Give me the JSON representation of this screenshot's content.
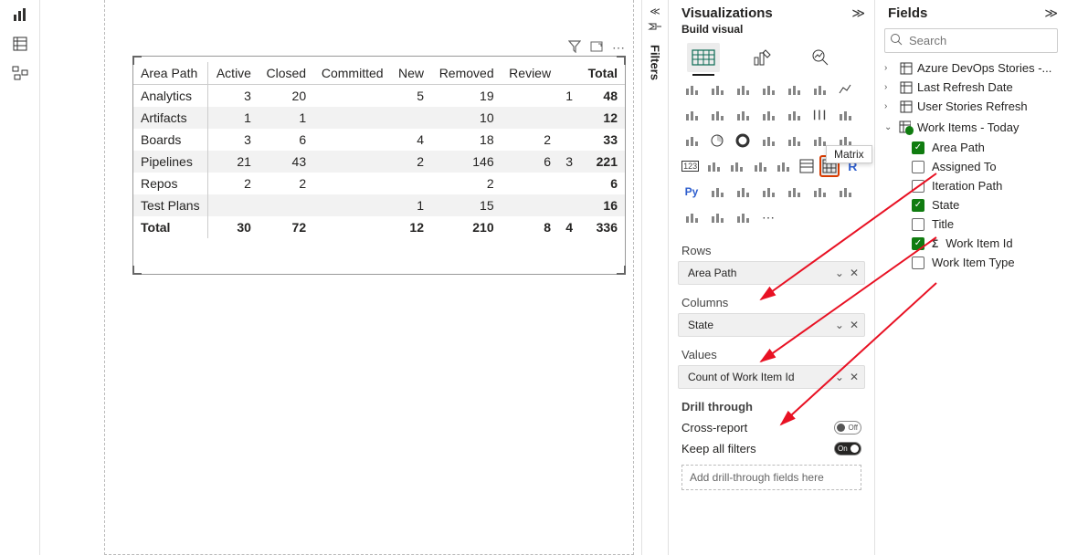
{
  "leftbar": {
    "items": [
      "bar-chart-icon",
      "table-icon",
      "model-icon"
    ]
  },
  "filters": {
    "label": "Filters"
  },
  "viz_panel": {
    "title": "Visualizations",
    "subtitle": "Build visual",
    "tooltip": "Matrix",
    "sections": {
      "rows": {
        "label": "Rows",
        "item": "Area Path"
      },
      "columns": {
        "label": "Columns",
        "item": "State"
      },
      "values": {
        "label": "Values",
        "item": "Count of Work Item Id"
      }
    },
    "drill": {
      "label": "Drill through",
      "cross_report": "Cross-report",
      "cross_report_state": "Off",
      "keep_filters": "Keep all filters",
      "keep_filters_state": "On",
      "drop": "Add drill-through fields here"
    }
  },
  "fields_panel": {
    "title": "Fields",
    "search_placeholder": "Search",
    "tables": [
      {
        "name": "Azure DevOps Stories -...",
        "expanded": false
      },
      {
        "name": "Last Refresh Date",
        "expanded": false
      },
      {
        "name": "User Stories Refresh",
        "expanded": false
      },
      {
        "name": "Work Items - Today",
        "expanded": true,
        "inuse": true,
        "fields": [
          {
            "name": "Area Path",
            "checked": true
          },
          {
            "name": "Assigned To",
            "checked": false
          },
          {
            "name": "Iteration Path",
            "checked": false
          },
          {
            "name": "State",
            "checked": true
          },
          {
            "name": "Title",
            "checked": false
          },
          {
            "name": "Work Item Id",
            "checked": true,
            "sigma": true
          },
          {
            "name": "Work Item Type",
            "checked": false
          }
        ]
      }
    ]
  },
  "chart_data": {
    "type": "table",
    "title": "",
    "row_field": "Area Path",
    "column_field": "State",
    "value_field": "Count of Work Item Id",
    "columns": [
      "Area Path",
      "Active",
      "Closed",
      "Committed",
      "New",
      "Removed",
      "Review",
      "Total"
    ],
    "rows": [
      {
        "Area Path": "Analytics",
        "Active": 3,
        "Closed": 20,
        "Committed": null,
        "New": 5,
        "Removed": 19,
        "Review": null,
        "_col6": 1,
        "Total": 48
      },
      {
        "Area Path": "Artifacts",
        "Active": 1,
        "Closed": 1,
        "Committed": null,
        "New": null,
        "Removed": 10,
        "Review": null,
        "_col6": null,
        "Total": 12
      },
      {
        "Area Path": "Boards",
        "Active": 3,
        "Closed": 6,
        "Committed": null,
        "New": 4,
        "Removed": 18,
        "Review": 2,
        "_col6": null,
        "Total": 33
      },
      {
        "Area Path": "Pipelines",
        "Active": 21,
        "Closed": 43,
        "Committed": null,
        "New": 2,
        "Removed": 146,
        "Review": 6,
        "_col6": 3,
        "Total": 221
      },
      {
        "Area Path": "Repos",
        "Active": 2,
        "Closed": 2,
        "Committed": null,
        "New": null,
        "Removed": 2,
        "Review": null,
        "_col6": null,
        "Total": 6
      },
      {
        "Area Path": "Test Plans",
        "Active": null,
        "Closed": null,
        "Committed": null,
        "New": 1,
        "Removed": 15,
        "Review": null,
        "_col6": null,
        "Total": 16
      }
    ],
    "totals": {
      "Area Path": "Total",
      "Active": 30,
      "Closed": 72,
      "Committed": null,
      "New": 12,
      "Removed": 210,
      "Review": 8,
      "_col6": 4,
      "Total": 336
    },
    "display_columns": [
      "Area Path",
      "Active",
      "Closed",
      "Committed",
      "New",
      "Removed",
      "Review",
      "Total"
    ],
    "cell_keys": [
      "Area Path",
      "Active",
      "Closed",
      "Committed",
      "New",
      "Removed",
      "Review",
      "_col6",
      "Total"
    ]
  },
  "visual_header": {
    "actions": [
      "filter-icon",
      "focus-icon",
      "more-icon"
    ]
  }
}
